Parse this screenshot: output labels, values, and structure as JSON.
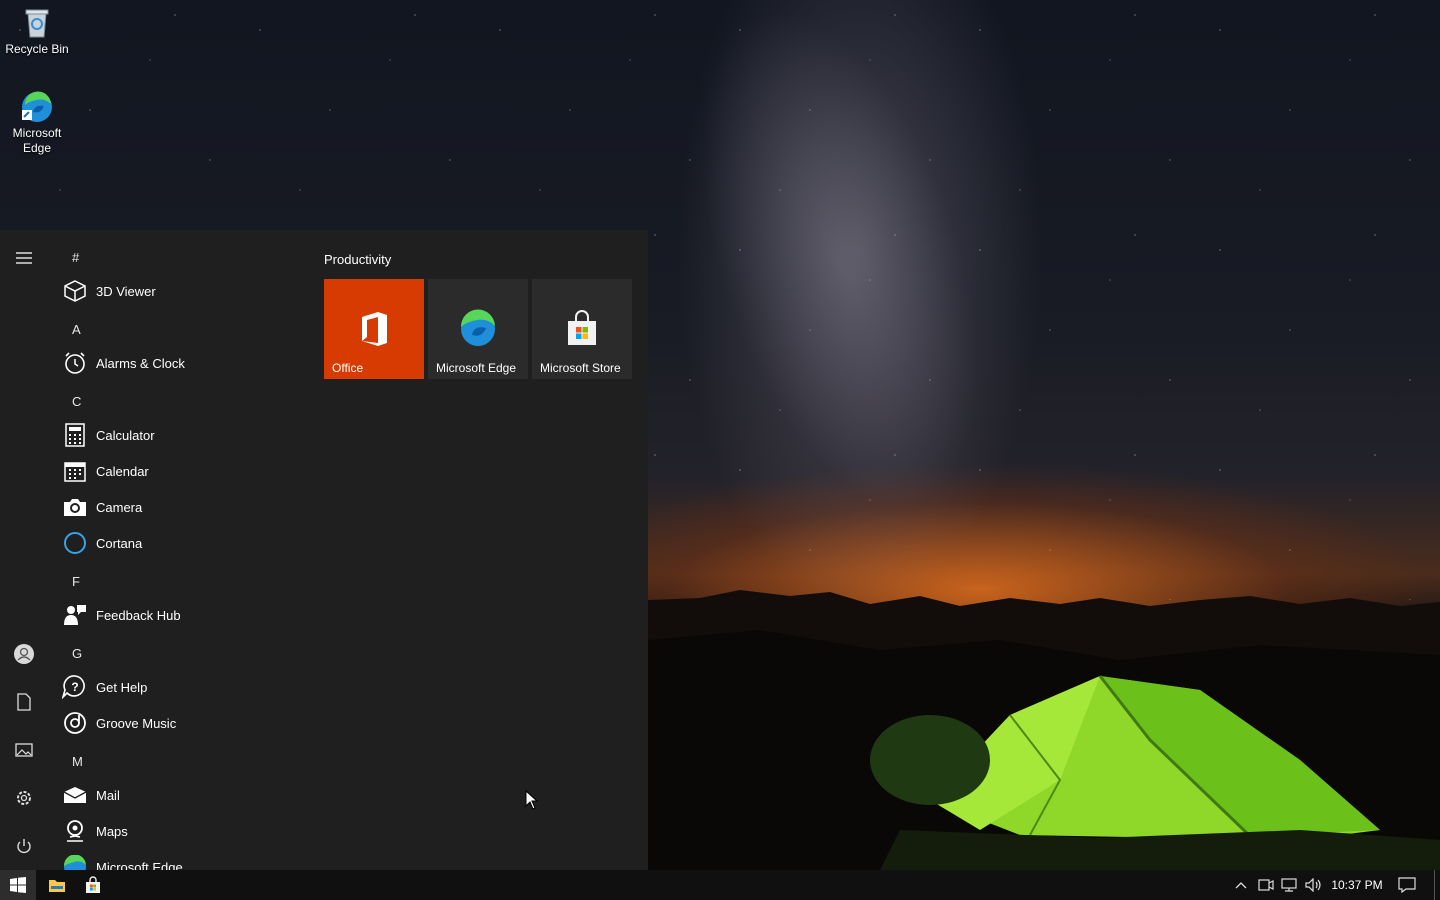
{
  "desktop": {
    "icons": [
      {
        "label": "Recycle Bin",
        "icon": "recycle-bin-icon"
      },
      {
        "label": "Microsoft\nEdge",
        "label_line1": "Microsoft",
        "label_line2": "Edge",
        "icon": "edge-icon"
      }
    ]
  },
  "start_menu": {
    "rail": [
      {
        "name": "menu",
        "icon": "hamburger-icon"
      },
      {
        "name": "account",
        "icon": "user-icon"
      },
      {
        "name": "documents",
        "icon": "document-icon"
      },
      {
        "name": "pictures",
        "icon": "pictures-icon"
      },
      {
        "name": "settings",
        "icon": "gear-icon"
      },
      {
        "name": "power",
        "icon": "power-icon"
      }
    ],
    "letters": {
      "hash": "#",
      "a": "A",
      "c": "C",
      "f": "F",
      "g": "G",
      "m": "M"
    },
    "apps": {
      "viewer3d": "3D Viewer",
      "alarms": "Alarms & Clock",
      "calculator": "Calculator",
      "calendar": "Calendar",
      "camera": "Camera",
      "cortana": "Cortana",
      "feedback": "Feedback Hub",
      "gethelp": "Get Help",
      "groove": "Groove Music",
      "mail": "Mail",
      "maps": "Maps",
      "edge": "Microsoft Edge"
    },
    "group_title": "Productivity",
    "tiles": [
      {
        "label": "Office",
        "color": "#d83b01"
      },
      {
        "label": "Microsoft Edge",
        "color": "#2b2b2b"
      },
      {
        "label": "Microsoft Store",
        "color": "#2b2b2b"
      }
    ]
  },
  "taskbar": {
    "clock": "10:37 PM",
    "pinned": [
      "windows-start-icon",
      "file-explorer-icon",
      "store-icon"
    ],
    "tray": [
      "chevron-up-icon",
      "meet-now-icon",
      "network-icon",
      "volume-icon"
    ],
    "notification": "action-center-icon"
  },
  "colors": {
    "accent": "#d83b01",
    "menu_bg": "#1f1f1f",
    "taskbar_bg": "#101010",
    "cortana": "#35a3e8"
  }
}
